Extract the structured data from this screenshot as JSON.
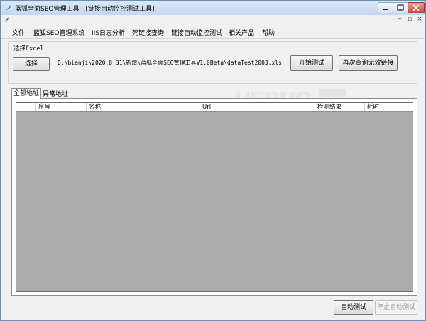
{
  "window": {
    "title": "蓝狐全面SEO管理工具 - [链接自动监控测试工具]"
  },
  "menu": [
    "文件",
    "蓝狐SEO管理系统",
    "IIS日志分析",
    "死链接查询",
    "链接自动监控测试",
    "相关产品",
    "帮助"
  ],
  "excel_group": {
    "label": "选择Excel",
    "select_button": "选择",
    "file_path": "D:\\bianji\\2020.8.31\\新增\\蓝狐全面SEO管理工具V1.0Beta\\dataTest2003.xls",
    "start_button": "开始测试",
    "recheck_button": "再次查询无效链接"
  },
  "tabs": [
    "全部地址",
    "异常地址"
  ],
  "grid": {
    "columns": [
      "序号",
      "名称",
      "Url",
      "检测结果",
      "耗时"
    ]
  },
  "footer": {
    "auto_test": "自动测试",
    "stop_auto_test": "停止自动测试"
  },
  "colors": {
    "grid_background": "#ababab",
    "titlebar": "#c4d7f0",
    "close_button": "#c9473a"
  }
}
